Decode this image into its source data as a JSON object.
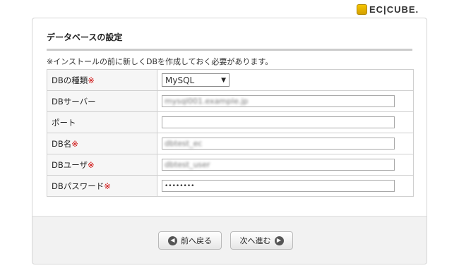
{
  "brand": {
    "logo_text": "EC|CUBE."
  },
  "section": {
    "title": "データベースの設定",
    "note": "※インストールの前に新しくDBを作成しておく必要があります。"
  },
  "form": {
    "required_mark": "※",
    "rows": [
      {
        "label": "DBの種類",
        "required": true,
        "type": "select",
        "value": "MySQL"
      },
      {
        "label": "DBサーバー",
        "required": false,
        "type": "text",
        "value": "mysql001.example.jp"
      },
      {
        "label": "ポート",
        "required": false,
        "type": "text",
        "value": ""
      },
      {
        "label": "DB名",
        "required": true,
        "type": "text",
        "value": "dbtest_ec"
      },
      {
        "label": "DBユーザ",
        "required": true,
        "type": "text",
        "value": "dbtest_user"
      },
      {
        "label": "DBパスワード",
        "required": true,
        "type": "password",
        "value": "••••••••"
      }
    ]
  },
  "buttons": {
    "back": "前へ戻る",
    "next": "次へ進む"
  },
  "icons": {
    "logo": "cube-icon",
    "back": "arrow-left-circle-icon",
    "next": "arrow-right-circle-icon"
  }
}
